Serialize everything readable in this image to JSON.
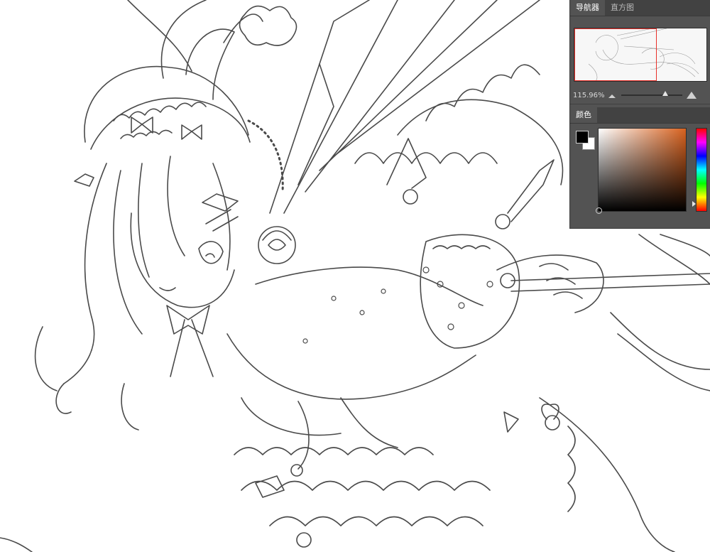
{
  "navigator_panel": {
    "tabs": [
      {
        "label": "导航器",
        "active": true
      },
      {
        "label": "直方图",
        "active": false
      }
    ],
    "zoom_level": "115.96%",
    "zoom_slider_fraction": 0.72
  },
  "color_panel": {
    "tab_label": "颜色",
    "foreground_color": "#000000",
    "background_color": "#ffffff",
    "selected_hue_color": "#d8621f"
  },
  "icons": {
    "zoom_out": "mountain-small-icon",
    "zoom_in": "mountain-large-icon",
    "hue_arrow": "triangle-pointer-icon"
  }
}
